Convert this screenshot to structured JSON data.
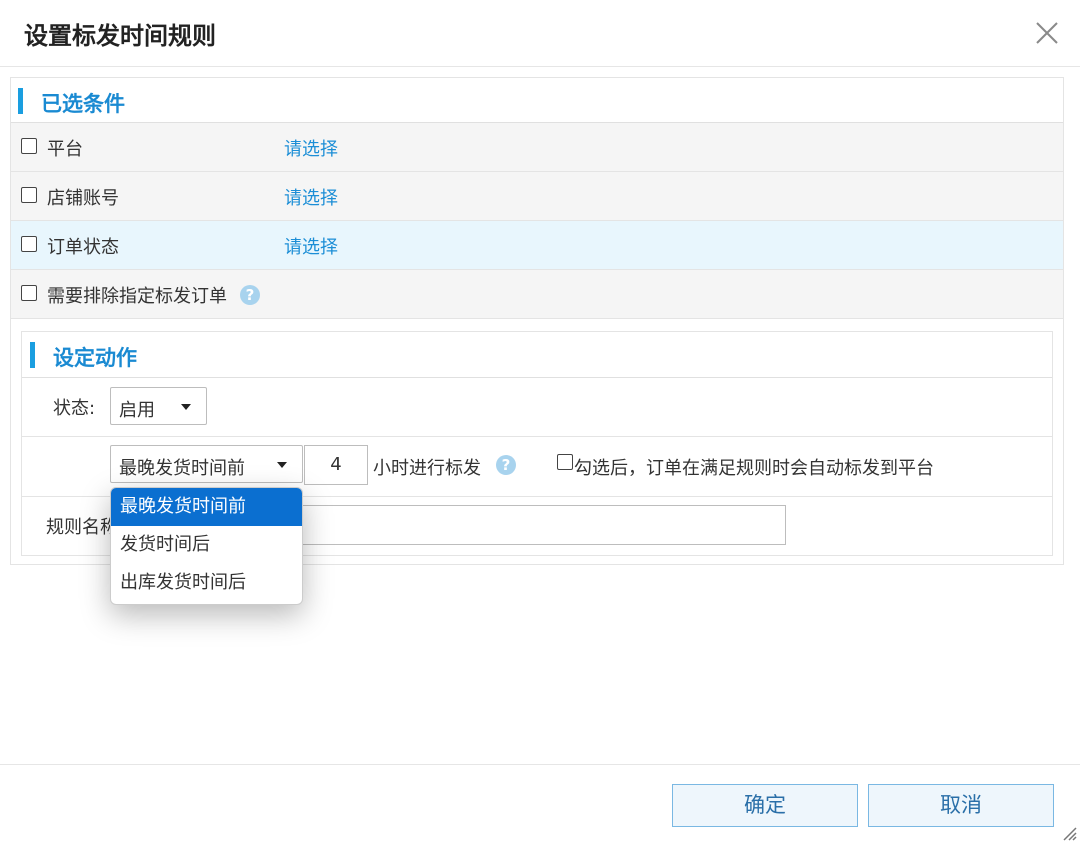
{
  "dialog": {
    "title": "设置标发时间规则"
  },
  "conditions": {
    "section_title": "已选条件",
    "rows": [
      {
        "label": "平台",
        "link": "请选择"
      },
      {
        "label": "店铺账号",
        "link": "请选择"
      },
      {
        "label": "订单状态",
        "link": "请选择"
      }
    ],
    "exclude_label": "需要排除指定标发订单"
  },
  "actions": {
    "section_title": "设定动作",
    "status_label": "状态:",
    "status_value": "启用",
    "time_base_value": "最晚发货时间前",
    "hours_value": "4",
    "hours_suffix": "小时进行标发",
    "auto_label": "勾选后，订单在满足规则时会自动标发到平台",
    "rule_name_label": "规则名称"
  },
  "dropdown": {
    "options": [
      "最晚发货时间前",
      "发货时间后",
      "出库发货时间后"
    ],
    "selected": "最晚发货时间前"
  },
  "footer": {
    "confirm_label": "确定",
    "cancel_label": "取消"
  },
  "help_glyph": "?",
  "colors": {
    "accent": "#1a9ee0",
    "link": "#1c8ed6",
    "selected_option": "#0b6fd0",
    "highlight_row": "#e8f6fd"
  },
  "icons": [
    "close-icon",
    "help-icon",
    "chevron-down-icon",
    "resize-grip-icon"
  ]
}
